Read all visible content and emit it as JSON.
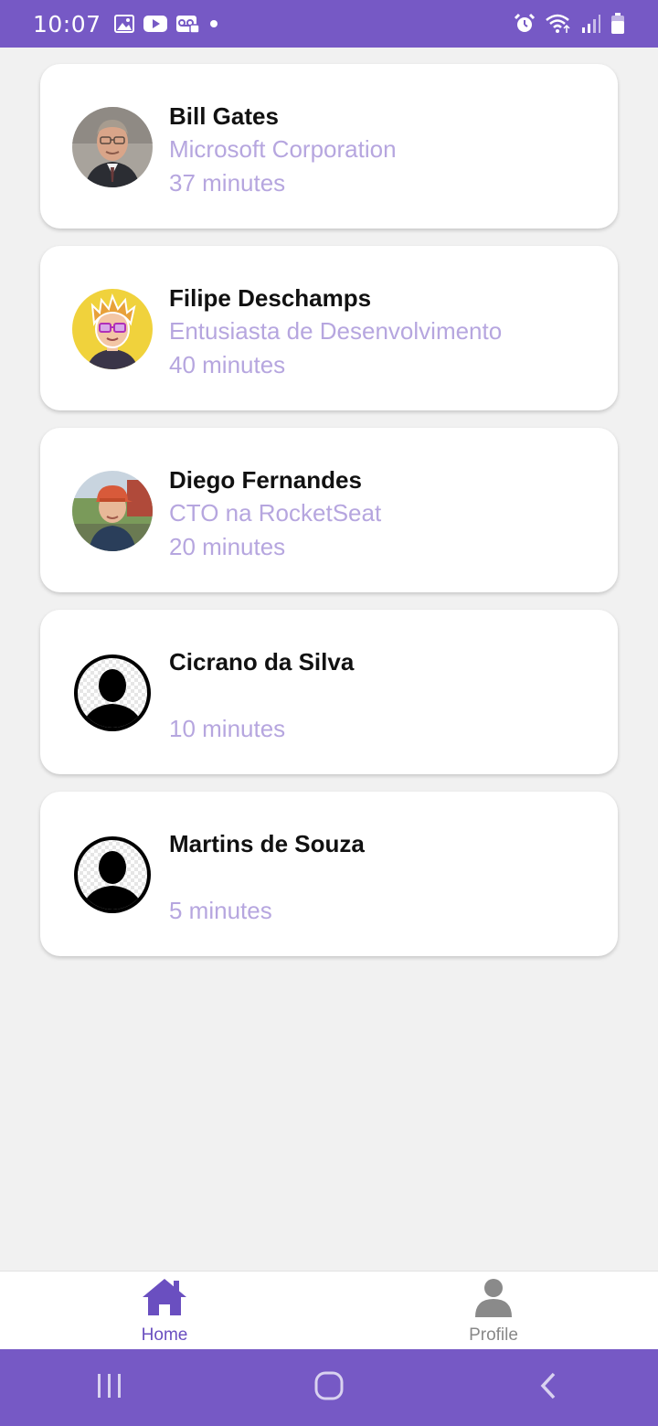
{
  "status_bar": {
    "time": "10:07",
    "left_icons": [
      "image-icon",
      "youtube-icon",
      "voicemail-icon",
      "dot-icon"
    ],
    "right_icons": [
      "alarm-icon",
      "wifi-icon",
      "signal-icon",
      "battery-icon"
    ]
  },
  "contacts": [
    {
      "name": "Bill Gates",
      "role": "Microsoft Corporation",
      "time": "37 minutes",
      "avatar": "photo-bill-gates"
    },
    {
      "name": "Filipe Deschamps",
      "role": "Entusiasta de Desenvolvimento",
      "time": "40 minutes",
      "avatar": "cartoon-avatar"
    },
    {
      "name": "Diego Fernandes",
      "role": "CTO na RocketSeat",
      "time": "20 minutes",
      "avatar": "photo-diego"
    },
    {
      "name": "Cicrano da Silva",
      "role": "",
      "time": "10 minutes",
      "avatar": "default-user-icon"
    },
    {
      "name": "Martins de Souza",
      "role": "",
      "time": "5 minutes",
      "avatar": "default-user-icon"
    }
  ],
  "tab_bar": {
    "home_label": "Home",
    "profile_label": "Profile",
    "active": "Home"
  },
  "colors": {
    "primary": "#7659c5",
    "subtitle": "#b6a6df",
    "background": "#f1f1f1"
  }
}
